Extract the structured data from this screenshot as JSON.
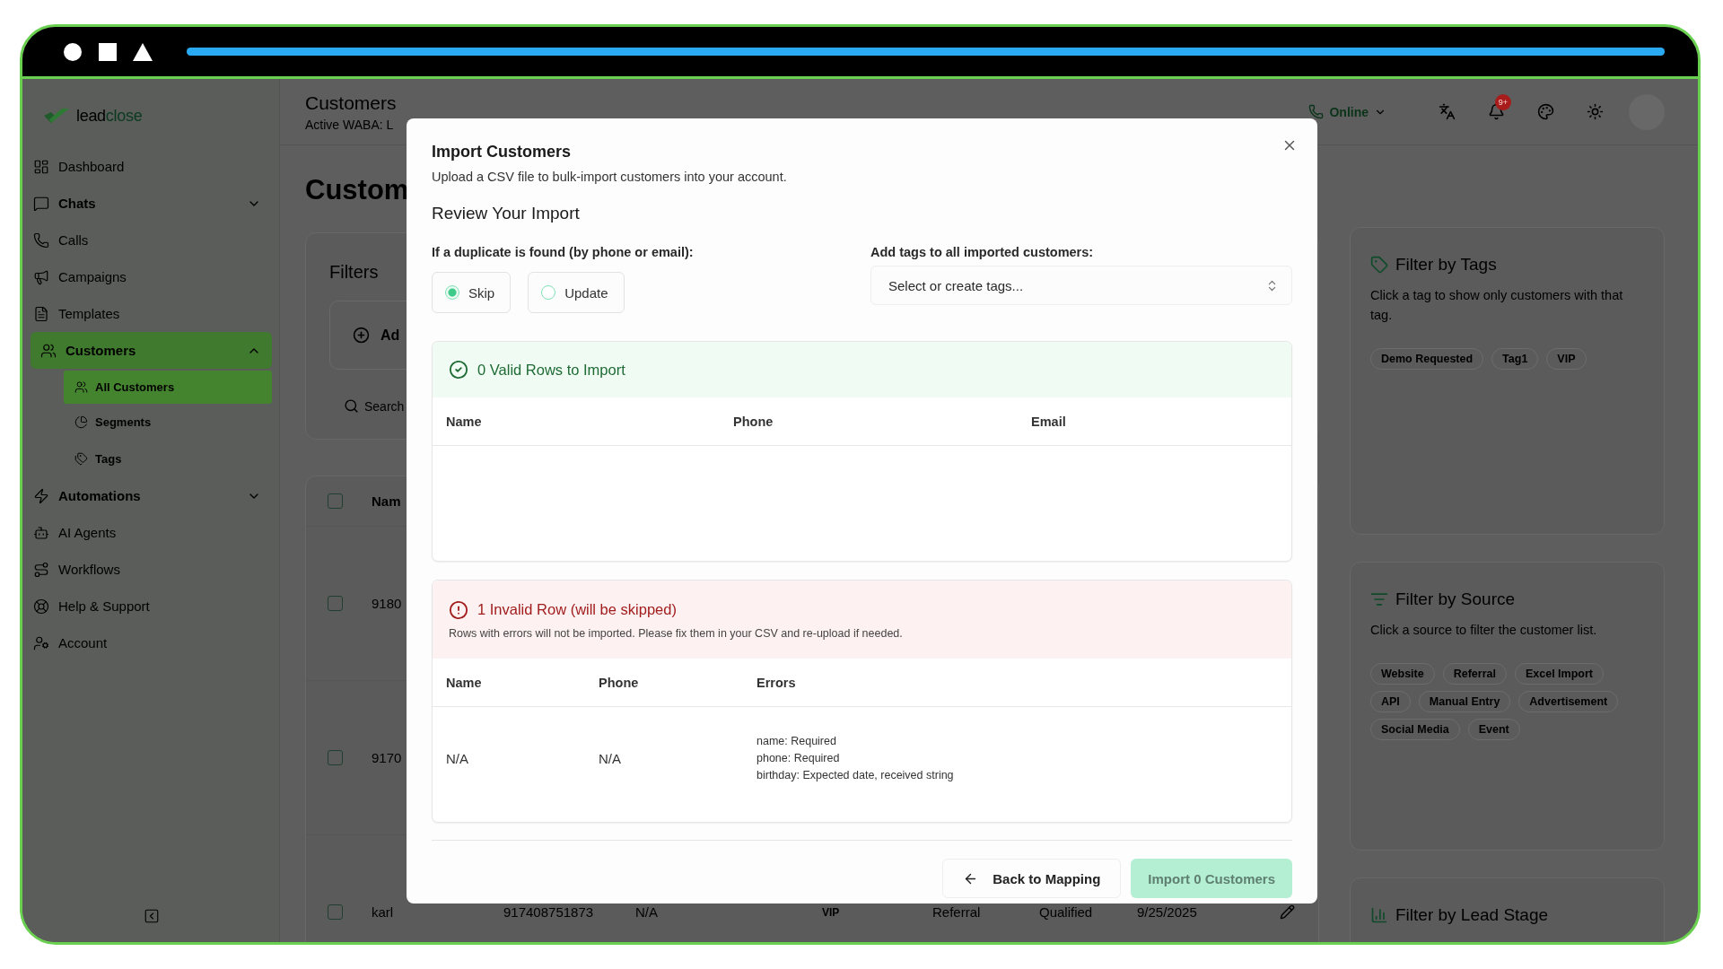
{
  "top_bar": {
    "level": 1
  },
  "sidebar": {
    "brand": [
      "lead",
      "close"
    ],
    "items": [
      {
        "label": "Dashboard",
        "selected": false
      },
      {
        "label": "Chats",
        "selected": false,
        "expanded": false
      },
      {
        "label": "Calls",
        "selected": false
      },
      {
        "label": "Campaigns",
        "selected": false
      },
      {
        "label": "Templates",
        "selected": false
      },
      {
        "label": "Customers",
        "selected": true,
        "expanded": true,
        "children": [
          {
            "label": "All Customers",
            "selected": true
          },
          {
            "label": "Segments",
            "selected": false
          },
          {
            "label": "Tags",
            "selected": false
          }
        ]
      },
      {
        "label": "Automations",
        "selected": false,
        "expanded": false
      },
      {
        "label": "AI Agents",
        "selected": false
      },
      {
        "label": "Workflows",
        "selected": false
      },
      {
        "label": "Help & Support",
        "selected": false
      },
      {
        "label": "Account",
        "selected": false
      }
    ]
  },
  "header": {
    "title": "Customers",
    "subtitle": "Active WABA: L",
    "status": "Online",
    "badge": "9+"
  },
  "page": {
    "heading": "Custom",
    "filters": {
      "title": "Filters",
      "add_button": "Ad",
      "search_placeholder": "Search"
    },
    "table": {
      "all_checked": false,
      "columns": [
        "Nam"
      ],
      "rows": [
        {
          "checked": false,
          "cells": [
            {
              "text": "9180",
              "kind": "text"
            }
          ]
        },
        {
          "checked": false,
          "cells": [
            {
              "text": "9170",
              "kind": "text"
            }
          ]
        },
        {
          "checked": false,
          "cells": [
            {
              "text": "karl",
              "kind": "text"
            },
            {
              "text": "917408751873",
              "kind": "text"
            },
            {
              "text": "N/A",
              "kind": "text"
            },
            {
              "text": "VIP",
              "kind": "tag"
            },
            {
              "text": "Referral",
              "kind": "text"
            },
            {
              "text": "Qualified",
              "kind": "text"
            },
            {
              "text": "9/25/2025",
              "kind": "text"
            }
          ]
        }
      ]
    }
  },
  "right_panel": [
    {
      "kind": "tags",
      "title": "Filter by Tags",
      "description": "Click a tag to show only customers with that tag.",
      "chips": [
        "Demo Requested",
        "Tag1",
        "VIP"
      ]
    },
    {
      "kind": "source",
      "title": "Filter by Source",
      "description": "Click a source to filter the customer list.",
      "chips": [
        "Website",
        "Referral",
        "Excel Import",
        "API",
        "Manual Entry",
        "Advertisement",
        "Social Media",
        "Event"
      ]
    },
    {
      "kind": "stage",
      "title": "Filter by Lead Stage"
    }
  ],
  "import_dialog": {
    "title": "Import Customers",
    "subtitle": "Upload a CSV file to bulk-import customers into your account.",
    "section_title": "Review Your Import",
    "duplicate_label": "If a duplicate is found (by phone or email):",
    "duplicate_options": [
      {
        "label": "Skip",
        "selected": true
      },
      {
        "label": "Update",
        "selected": false
      }
    ],
    "tags_label": "Add tags to all imported customers:",
    "tags_placeholder": "Select or create tags...",
    "valid": {
      "title": "0 Valid Rows to Import",
      "columns": [
        "Name",
        "Phone",
        "Email"
      ]
    },
    "invalid": {
      "title": "1 Invalid Row (will be skipped)",
      "description": "Rows with errors will not be imported. Please fix them in your CSV and re-upload if needed.",
      "columns": [
        "Name",
        "Phone",
        "Errors"
      ],
      "rows": [
        {
          "cells": [
            "N/A",
            "N/A"
          ],
          "errors": [
            "name: Required",
            "phone: Required",
            "birthday: Expected date, received string"
          ]
        }
      ]
    },
    "buttons": [
      {
        "label": "Back to Mapping",
        "kind": "back",
        "disabled": false
      },
      {
        "label": "Import 0 Customers",
        "kind": "primary",
        "disabled": true
      }
    ]
  }
}
